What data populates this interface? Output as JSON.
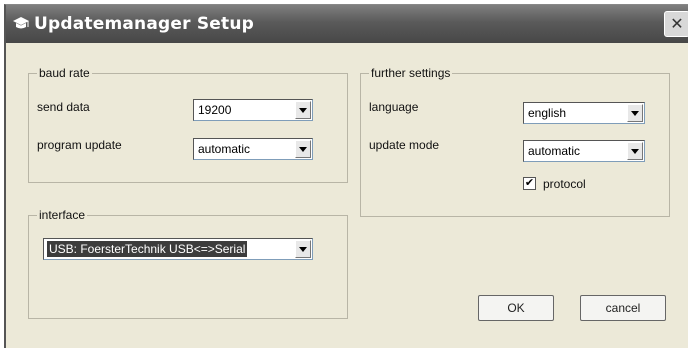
{
  "window": {
    "title": "Updatemanager Setup",
    "app_icon": "graduation-cap-icon",
    "close_icon": "close-icon",
    "close_glyph": "✕"
  },
  "baud_rate": {
    "legend": "baud rate",
    "send_data_label": "send data",
    "send_data_value": "19200",
    "program_update_label": "program update",
    "program_update_value": "automatic"
  },
  "interface": {
    "legend": "interface",
    "value": "USB: FoersterTechnik USB<=>Serial"
  },
  "further_settings": {
    "legend": "further settings",
    "language_label": "language",
    "language_value": "english",
    "update_mode_label": "update mode",
    "update_mode_value": "automatic",
    "protocol_label": "protocol",
    "protocol_checked": true,
    "check_glyph": "✔"
  },
  "buttons": {
    "ok": "OK",
    "cancel": "cancel"
  }
}
